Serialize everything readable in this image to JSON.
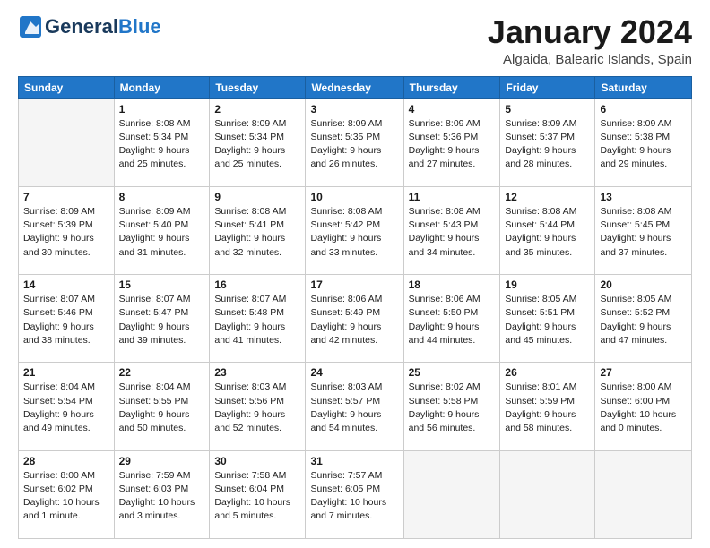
{
  "header": {
    "logo_general": "General",
    "logo_blue": "Blue",
    "month_title": "January 2024",
    "location": "Algaida, Balearic Islands, Spain"
  },
  "weekdays": [
    "Sunday",
    "Monday",
    "Tuesday",
    "Wednesday",
    "Thursday",
    "Friday",
    "Saturday"
  ],
  "weeks": [
    [
      {
        "day": "",
        "sunrise": "",
        "sunset": "",
        "daylight": ""
      },
      {
        "day": "1",
        "sunrise": "Sunrise: 8:08 AM",
        "sunset": "Sunset: 5:34 PM",
        "daylight": "Daylight: 9 hours and 25 minutes."
      },
      {
        "day": "2",
        "sunrise": "Sunrise: 8:09 AM",
        "sunset": "Sunset: 5:34 PM",
        "daylight": "Daylight: 9 hours and 25 minutes."
      },
      {
        "day": "3",
        "sunrise": "Sunrise: 8:09 AM",
        "sunset": "Sunset: 5:35 PM",
        "daylight": "Daylight: 9 hours and 26 minutes."
      },
      {
        "day": "4",
        "sunrise": "Sunrise: 8:09 AM",
        "sunset": "Sunset: 5:36 PM",
        "daylight": "Daylight: 9 hours and 27 minutes."
      },
      {
        "day": "5",
        "sunrise": "Sunrise: 8:09 AM",
        "sunset": "Sunset: 5:37 PM",
        "daylight": "Daylight: 9 hours and 28 minutes."
      },
      {
        "day": "6",
        "sunrise": "Sunrise: 8:09 AM",
        "sunset": "Sunset: 5:38 PM",
        "daylight": "Daylight: 9 hours and 29 minutes."
      }
    ],
    [
      {
        "day": "7",
        "sunrise": "Sunrise: 8:09 AM",
        "sunset": "Sunset: 5:39 PM",
        "daylight": "Daylight: 9 hours and 30 minutes."
      },
      {
        "day": "8",
        "sunrise": "Sunrise: 8:09 AM",
        "sunset": "Sunset: 5:40 PM",
        "daylight": "Daylight: 9 hours and 31 minutes."
      },
      {
        "day": "9",
        "sunrise": "Sunrise: 8:08 AM",
        "sunset": "Sunset: 5:41 PM",
        "daylight": "Daylight: 9 hours and 32 minutes."
      },
      {
        "day": "10",
        "sunrise": "Sunrise: 8:08 AM",
        "sunset": "Sunset: 5:42 PM",
        "daylight": "Daylight: 9 hours and 33 minutes."
      },
      {
        "day": "11",
        "sunrise": "Sunrise: 8:08 AM",
        "sunset": "Sunset: 5:43 PM",
        "daylight": "Daylight: 9 hours and 34 minutes."
      },
      {
        "day": "12",
        "sunrise": "Sunrise: 8:08 AM",
        "sunset": "Sunset: 5:44 PM",
        "daylight": "Daylight: 9 hours and 35 minutes."
      },
      {
        "day": "13",
        "sunrise": "Sunrise: 8:08 AM",
        "sunset": "Sunset: 5:45 PM",
        "daylight": "Daylight: 9 hours and 37 minutes."
      }
    ],
    [
      {
        "day": "14",
        "sunrise": "Sunrise: 8:07 AM",
        "sunset": "Sunset: 5:46 PM",
        "daylight": "Daylight: 9 hours and 38 minutes."
      },
      {
        "day": "15",
        "sunrise": "Sunrise: 8:07 AM",
        "sunset": "Sunset: 5:47 PM",
        "daylight": "Daylight: 9 hours and 39 minutes."
      },
      {
        "day": "16",
        "sunrise": "Sunrise: 8:07 AM",
        "sunset": "Sunset: 5:48 PM",
        "daylight": "Daylight: 9 hours and 41 minutes."
      },
      {
        "day": "17",
        "sunrise": "Sunrise: 8:06 AM",
        "sunset": "Sunset: 5:49 PM",
        "daylight": "Daylight: 9 hours and 42 minutes."
      },
      {
        "day": "18",
        "sunrise": "Sunrise: 8:06 AM",
        "sunset": "Sunset: 5:50 PM",
        "daylight": "Daylight: 9 hours and 44 minutes."
      },
      {
        "day": "19",
        "sunrise": "Sunrise: 8:05 AM",
        "sunset": "Sunset: 5:51 PM",
        "daylight": "Daylight: 9 hours and 45 minutes."
      },
      {
        "day": "20",
        "sunrise": "Sunrise: 8:05 AM",
        "sunset": "Sunset: 5:52 PM",
        "daylight": "Daylight: 9 hours and 47 minutes."
      }
    ],
    [
      {
        "day": "21",
        "sunrise": "Sunrise: 8:04 AM",
        "sunset": "Sunset: 5:54 PM",
        "daylight": "Daylight: 9 hours and 49 minutes."
      },
      {
        "day": "22",
        "sunrise": "Sunrise: 8:04 AM",
        "sunset": "Sunset: 5:55 PM",
        "daylight": "Daylight: 9 hours and 50 minutes."
      },
      {
        "day": "23",
        "sunrise": "Sunrise: 8:03 AM",
        "sunset": "Sunset: 5:56 PM",
        "daylight": "Daylight: 9 hours and 52 minutes."
      },
      {
        "day": "24",
        "sunrise": "Sunrise: 8:03 AM",
        "sunset": "Sunset: 5:57 PM",
        "daylight": "Daylight: 9 hours and 54 minutes."
      },
      {
        "day": "25",
        "sunrise": "Sunrise: 8:02 AM",
        "sunset": "Sunset: 5:58 PM",
        "daylight": "Daylight: 9 hours and 56 minutes."
      },
      {
        "day": "26",
        "sunrise": "Sunrise: 8:01 AM",
        "sunset": "Sunset: 5:59 PM",
        "daylight": "Daylight: 9 hours and 58 minutes."
      },
      {
        "day": "27",
        "sunrise": "Sunrise: 8:00 AM",
        "sunset": "Sunset: 6:00 PM",
        "daylight": "Daylight: 10 hours and 0 minutes."
      }
    ],
    [
      {
        "day": "28",
        "sunrise": "Sunrise: 8:00 AM",
        "sunset": "Sunset: 6:02 PM",
        "daylight": "Daylight: 10 hours and 1 minute."
      },
      {
        "day": "29",
        "sunrise": "Sunrise: 7:59 AM",
        "sunset": "Sunset: 6:03 PM",
        "daylight": "Daylight: 10 hours and 3 minutes."
      },
      {
        "day": "30",
        "sunrise": "Sunrise: 7:58 AM",
        "sunset": "Sunset: 6:04 PM",
        "daylight": "Daylight: 10 hours and 5 minutes."
      },
      {
        "day": "31",
        "sunrise": "Sunrise: 7:57 AM",
        "sunset": "Sunset: 6:05 PM",
        "daylight": "Daylight: 10 hours and 7 minutes."
      },
      {
        "day": "",
        "sunrise": "",
        "sunset": "",
        "daylight": ""
      },
      {
        "day": "",
        "sunrise": "",
        "sunset": "",
        "daylight": ""
      },
      {
        "day": "",
        "sunrise": "",
        "sunset": "",
        "daylight": ""
      }
    ]
  ]
}
